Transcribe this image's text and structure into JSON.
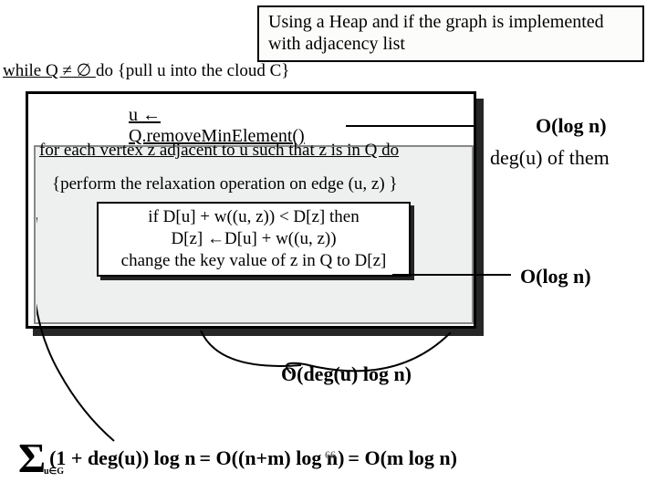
{
  "callout": "Using a Heap and if the graph is implemented with adjacency list",
  "while_prefix": "while Q ",
  "while_neq": "≠",
  "while_empty": " ∅ ",
  "while_suffix": "do {pull u into the cloud C}",
  "remove_line": "u ← Q.removeMinElement()",
  "for_each": "for each vertex z adjacent to u such that z is in Q do",
  "perform": "{perform the relaxation operation on edge (u, z) }",
  "ifblock": {
    "l1": "if D[u] + w((u, z)) < D[z] then",
    "l2": "D[z] ←D[u] + w((u, z))",
    "l3": "change the key value of z in Q to D[z]"
  },
  "complexity": {
    "remove": "O(log n)",
    "deg_of_them": "deg(u) of them",
    "relax": "O(log n)",
    "inner": "O(deg(u) log n)"
  },
  "final": {
    "sigma_sub": "u∈G",
    "body1": "(1 + deg(u)) log n",
    "eq1": "= O((n+m) log n)",
    "eq2": "= O(m log n)"
  },
  "slide_no": "66"
}
